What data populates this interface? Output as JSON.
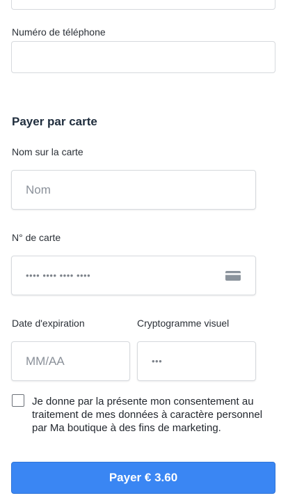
{
  "contact": {
    "phone_label": "Numéro de téléphone",
    "phone_value": ""
  },
  "card_section": {
    "title": "Payer par carte",
    "name_label": "Nom sur la carte",
    "name_placeholder": "Nom",
    "number_label": "N° de carte",
    "number_placeholder": "•••• •••• •••• ••••",
    "card_icon": "credit-card-icon",
    "expiry_label": "Date d'expiration",
    "expiry_placeholder": "MM/AA",
    "cvc_label": "Cryptogramme visuel",
    "cvc_placeholder": "•••"
  },
  "consent": {
    "checked": false,
    "text": "Je donne par la présente mon consentement au traitement de mes données à caractère personnel par Ma boutique à des fins de marketing."
  },
  "pay_button": {
    "label": "Payer € 3.60",
    "color": "#3a86f3"
  }
}
